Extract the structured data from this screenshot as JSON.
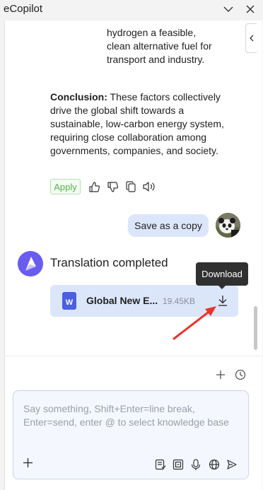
{
  "window": {
    "title": "eCopilot"
  },
  "chat": {
    "para1": "hydrogen a feasible, clean alternative fuel for transport and industry.",
    "conclusion_label": "Conclusion:",
    "conclusion_text": "These factors collectively drive the global shift towards a sustainable, low-carbon energy system, requiring close collaboration among governments, companies, and society.",
    "apply_label": "Apply",
    "user_message": "Save as a copy",
    "bot_message": "Translation completed",
    "file": {
      "name": "Global New E...",
      "size": "19.45KB",
      "type_letter": "W"
    },
    "tooltip": "Download"
  },
  "input": {
    "placeholder": "Say something, Shift+Enter=line break, Enter=send, enter @ to select knowledge base"
  },
  "colors": {
    "accent": "#dce6fb",
    "apply_green": "#52b64b",
    "bot_logo": "#6b5cf0",
    "arrow_red": "#e8352c"
  }
}
